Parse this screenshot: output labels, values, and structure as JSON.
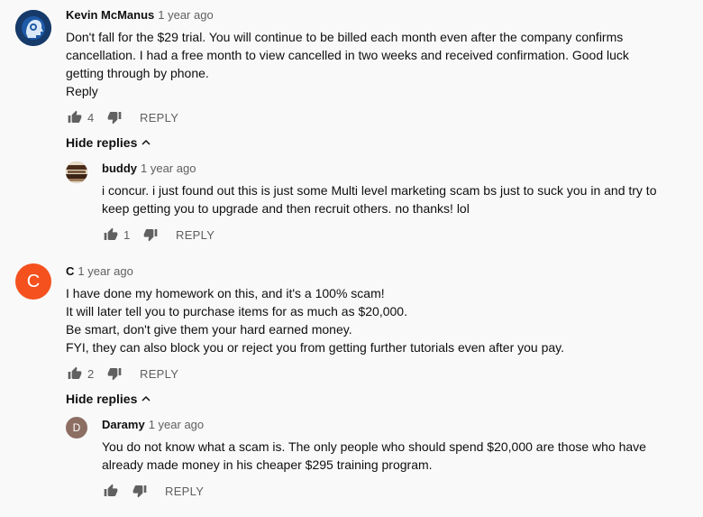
{
  "comments": [
    {
      "author": "Kevin McManus",
      "time": "1 year ago",
      "lines": [
        "Don't fall for the $29 trial. You will continue to be billed each month even after the company confirms",
        "cancellation. I had a free month to view cancelled in two weeks and received confirmation. Good luck",
        "getting through by phone."
      ],
      "reply_link": "Reply",
      "likes": "4",
      "reply_label": "REPLY",
      "toggle_label": "Hide replies",
      "replies": [
        {
          "author": "buddy",
          "time": "1 year ago",
          "lines": [
            "i concur. i just found out this is just some Multi level marketing scam bs just to suck you in and try to",
            "keep getting you to upgrade and then recruit others. no thanks! lol"
          ],
          "likes": "1",
          "reply_label": "REPLY"
        }
      ]
    },
    {
      "author": "C",
      "avatar_letter": "C",
      "avatar_color": "#f4511e",
      "time": "1 year ago",
      "lines": [
        "I have done my homework on this, and it's a 100% scam!",
        "It will later tell you to purchase items for as much as $20,000.",
        "Be smart, don't give them your hard earned money.",
        "FYI, they can also block you or reject you from getting further tutorials even after you pay."
      ],
      "likes": "2",
      "reply_label": "REPLY",
      "toggle_label": "Hide replies",
      "replies": [
        {
          "author": "Daramy",
          "avatar_letter": "D",
          "avatar_color": "#8d6e63",
          "time": "1 year ago",
          "lines": [
            "You do not know what a scam is. The only people who should spend $20,000 are those who have",
            "already made money in his cheaper $295 training program."
          ],
          "likes": "",
          "reply_label": "REPLY"
        }
      ]
    }
  ],
  "icons": {
    "like": "thumbs-up-icon",
    "dislike": "thumbs-down-icon",
    "toggle": "chevron-up-icon"
  }
}
